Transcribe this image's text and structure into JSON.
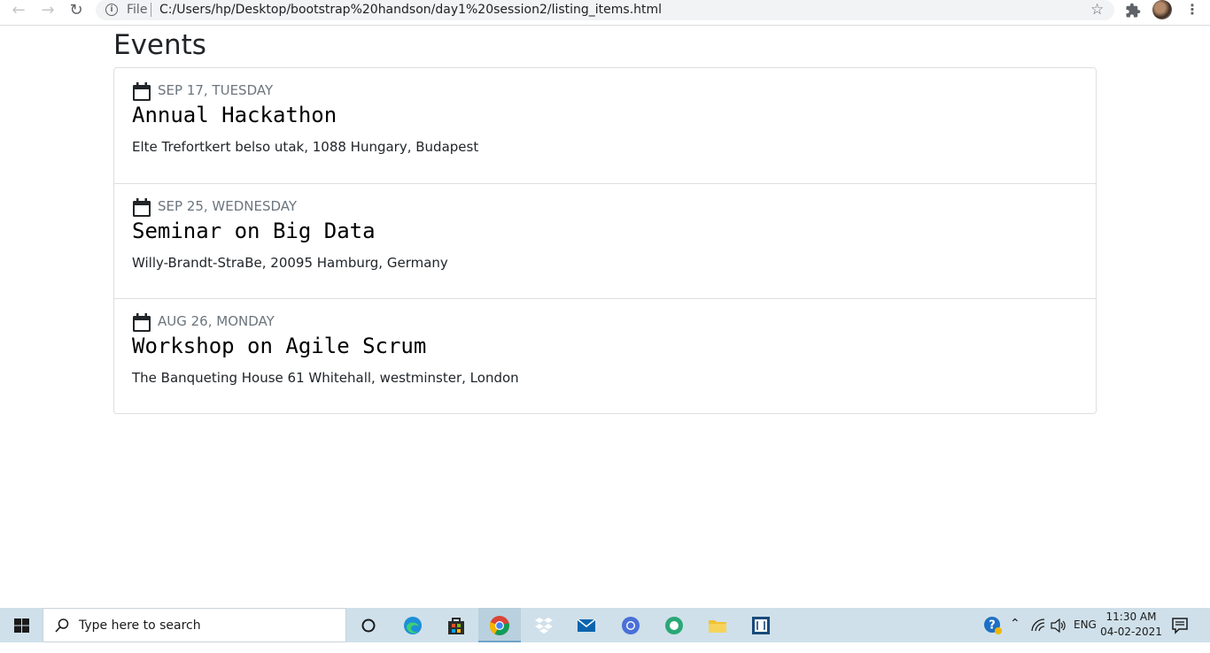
{
  "browser": {
    "scheme_label": "File",
    "url": "C:/Users/hp/Desktop/bootstrap%20handson/day1%20session2/listing_items.html"
  },
  "page": {
    "title": "Events",
    "events": [
      {
        "date": "SEP 17, TUESDAY",
        "name": "Annual Hackathon",
        "location": "Elte Trefortkert belso utak, 1088 Hungary, Budapest"
      },
      {
        "date": "SEP 25, WEDNESDAY",
        "name": "Seminar on Big Data",
        "location": "Willy-Brandt-StraBe, 20095 Hamburg, Germany"
      },
      {
        "date": "AUG 26, MONDAY",
        "name": "Workshop on Agile Scrum",
        "location": "The Banqueting House 61 Whitehall, westminster, London"
      }
    ]
  },
  "taskbar": {
    "search_placeholder": "Type here to search",
    "apps": [
      "cortana-icon",
      "edge-icon",
      "store-icon",
      "chrome-icon",
      "dropbox-icon",
      "mail-icon",
      "chrome-alt-icon",
      "edge-dev-icon",
      "file-explorer-icon",
      "code-editor-icon"
    ],
    "language": "ENG",
    "time": "11:30 AM",
    "date": "04-02-2021"
  }
}
